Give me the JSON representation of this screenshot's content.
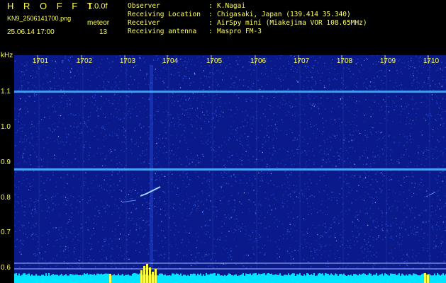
{
  "header": {
    "app_name": "H R O F F T",
    "version": "1.0.0f",
    "filename": "KN9_2506141700.png",
    "mode": "meteor",
    "datetime": "25.06.14 17:00",
    "count": "13"
  },
  "station": [
    {
      "key": "Observer",
      "value": "K.Nagai"
    },
    {
      "key": "Receiving Location",
      "value": "Chigasaki, Japan (139.414 35.340)"
    },
    {
      "key": "Receiver",
      "value": "AirSpy mini (Miakejima VOR 108.65MHz)"
    },
    {
      "key": "Receiving antenna",
      "value": "Maspro FM-3"
    }
  ],
  "separator": ":",
  "spectrogram": {
    "y_unit": "kHz",
    "y_ticks": [
      "1.1",
      "1.0",
      "0.9",
      "0.8",
      "0.7",
      "0.6"
    ],
    "x_ticks": [
      "1701",
      "1702",
      "1703",
      "1704",
      "1705",
      "1706",
      "1707",
      "1708",
      "1709",
      "1710"
    ],
    "colors": {
      "background": "#0a1a8a",
      "noise": "#3a6cff",
      "carrier": "#4fb0ff",
      "bottom_band": "#00e5ff",
      "peak": "#ffff44",
      "axis_text": "#ffff55"
    }
  }
}
